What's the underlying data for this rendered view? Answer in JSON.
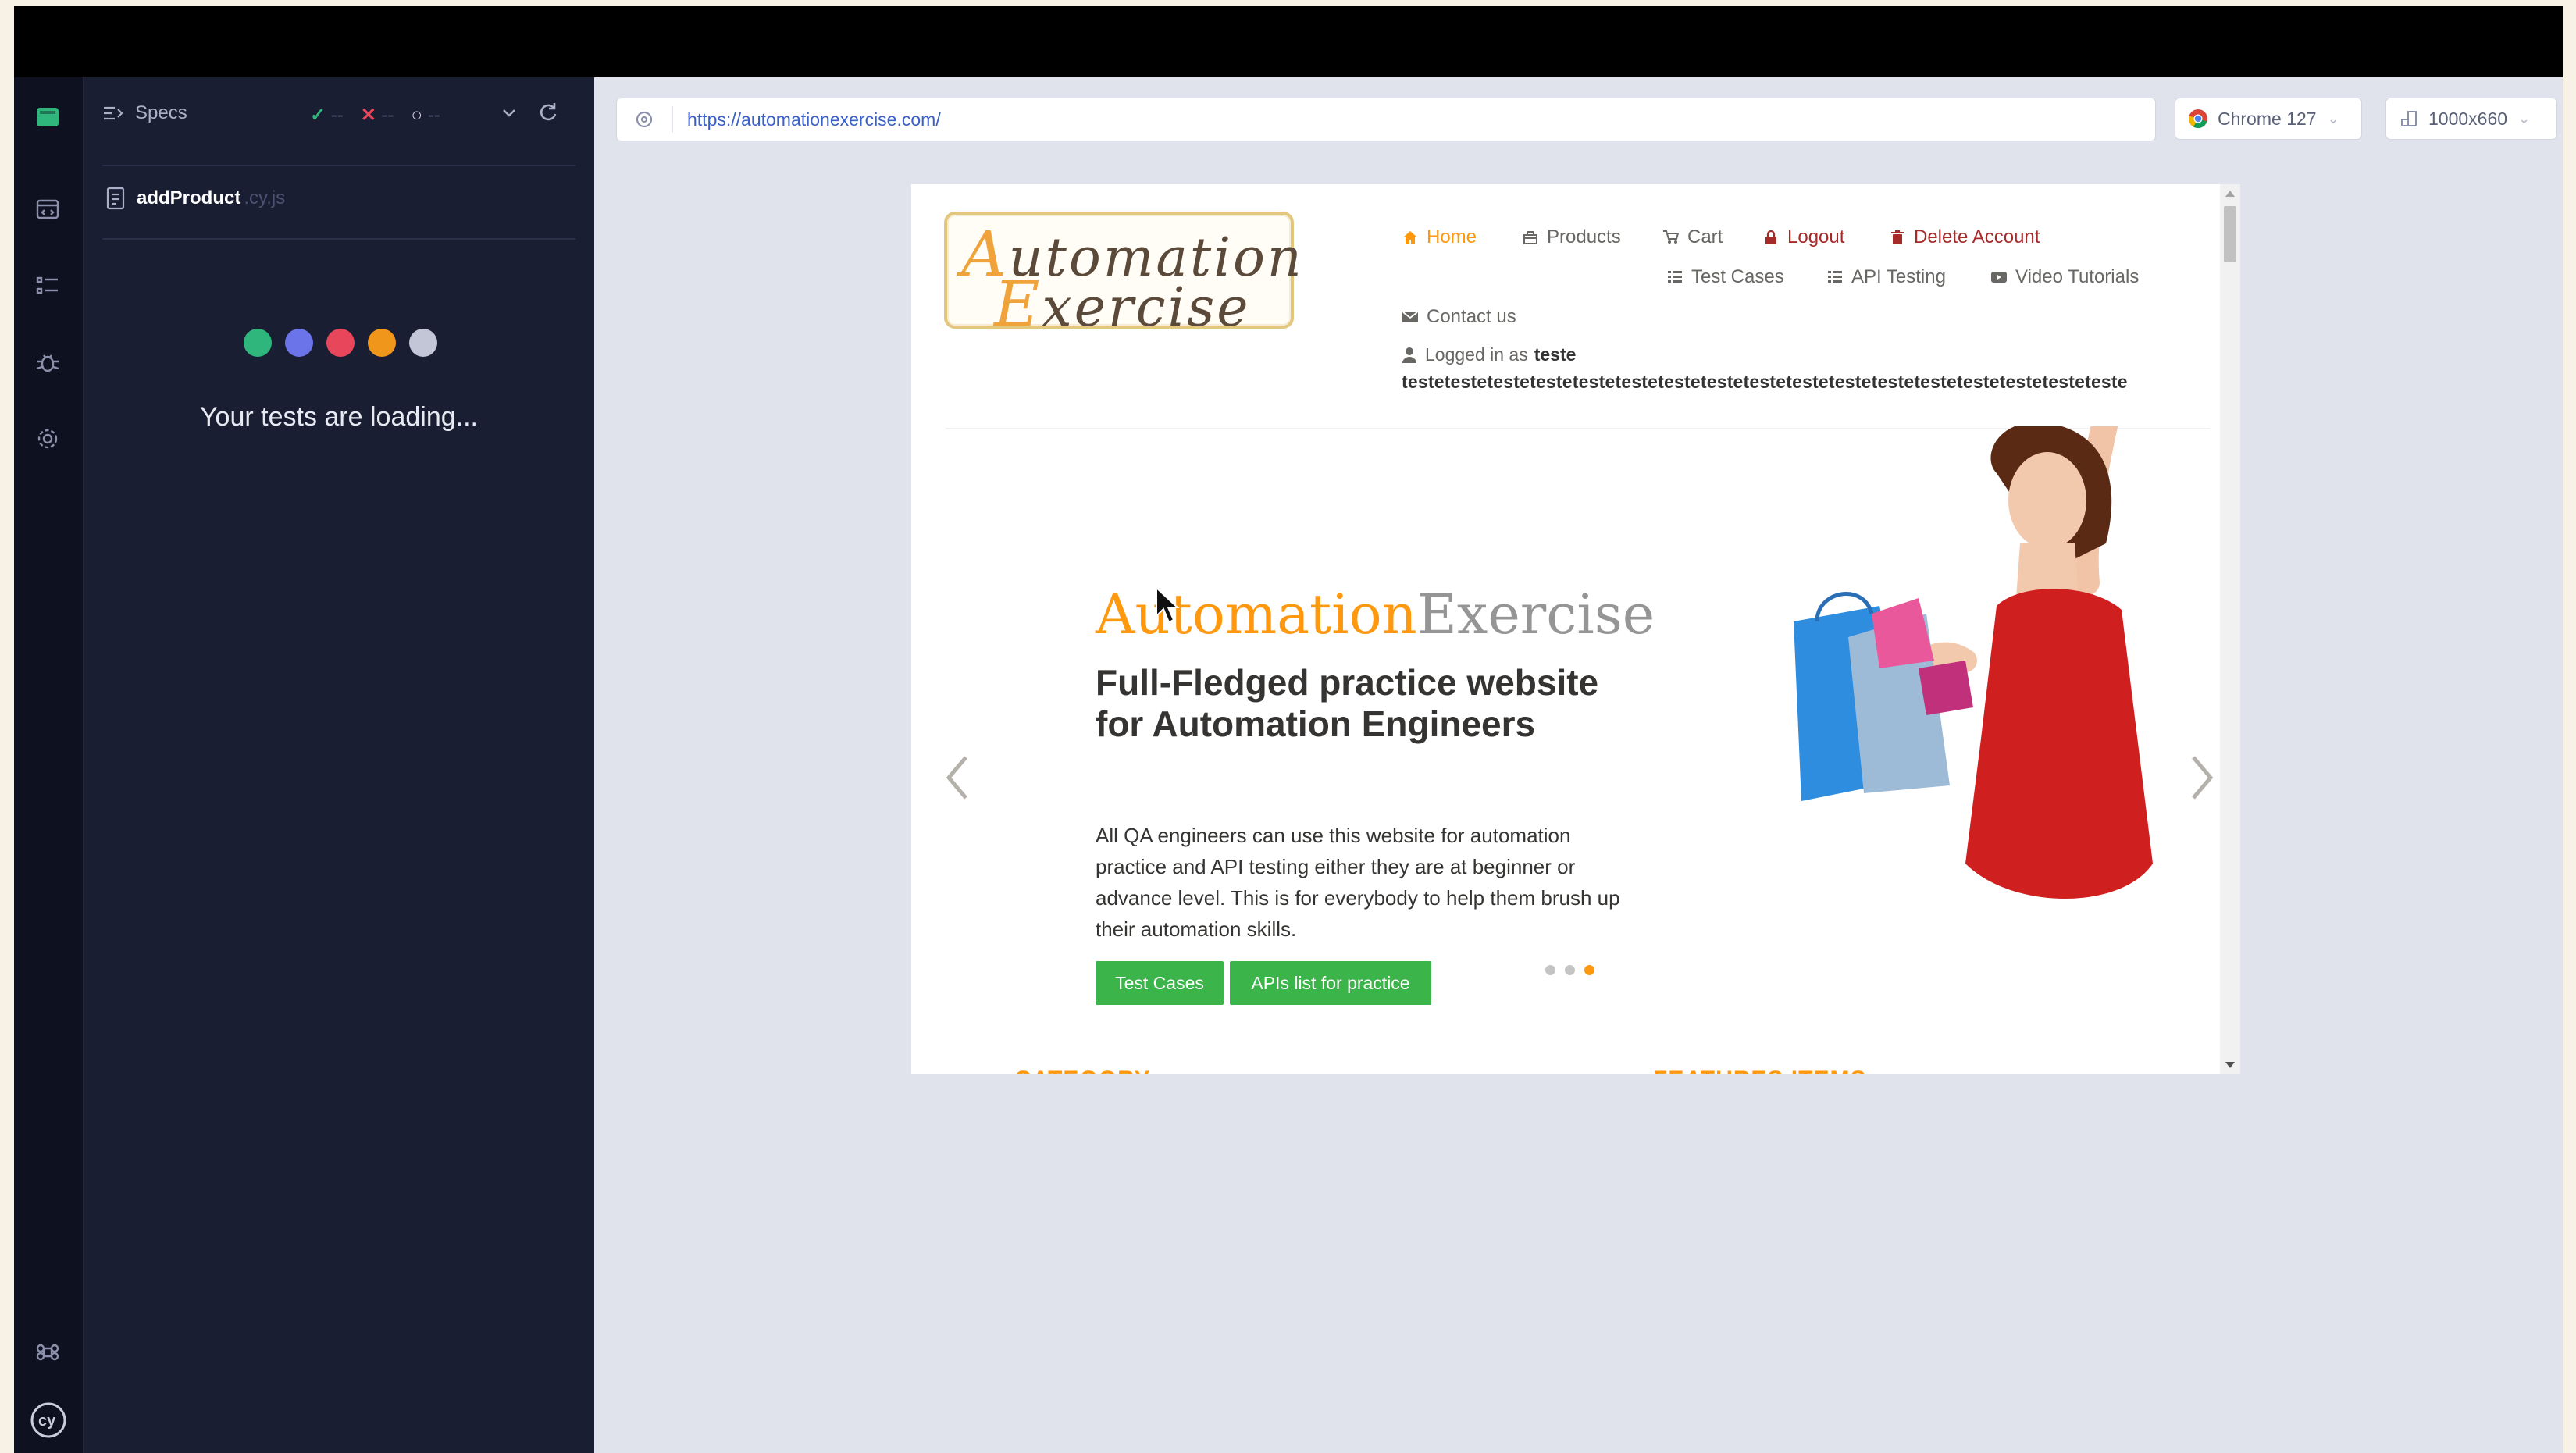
{
  "colors": {
    "cypress_dark": "#1a1e33",
    "cypress_rail": "#0e1120",
    "pass": "#2fb67c",
    "fail": "#e8465b",
    "accent_orange": "#fe980f",
    "green_button": "#3bb54a",
    "link_blue": "#3a61c9"
  },
  "cypress": {
    "specs_label": "Specs",
    "stats": {
      "passed": "✓",
      "failed": "✕",
      "pending": "○",
      "placeholder": "--"
    },
    "spec_file": {
      "name": "addProduct",
      "ext": ".cy.js"
    },
    "loading_text": "Your tests are loading...",
    "loader_dots": [
      "#2fb67c",
      "#6b74e8",
      "#e8465b",
      "#f0961a",
      "#c2c6d6"
    ],
    "rail_icons": [
      "cypress-logo-icon",
      "browser-window-icon",
      "list-icon",
      "bug-icon",
      "gear-icon",
      "command-key-icon",
      "cy-logo-icon"
    ]
  },
  "browser": {
    "url": "https://automationexercise.com/",
    "browser_name": "Chrome 127",
    "viewport_size": "1000x660"
  },
  "site": {
    "logo_line1": "Automation",
    "logo_line2": "Exercise",
    "nav": {
      "home": "Home",
      "products": "Products",
      "cart": "Cart",
      "logout": "Logout",
      "delete_account": "Delete Account",
      "test_cases": "Test Cases",
      "api_testing": "API Testing",
      "video_tutorials": "Video Tutorials",
      "contact_us": "Contact us"
    },
    "logged_in_prefix": "Logged in as",
    "logged_in_user": "teste",
    "logged_in_user_cont": "testetestetestetestetestetestetestetestetestetestetestetestetestetestetestetesteteste",
    "hero": {
      "title_a": "Automation",
      "title_b": "Exercise",
      "subtitle": "Full-Fledged practice website for Automation Engineers",
      "body": "All QA engineers can use this website for automation practice and API testing either they are at beginner or advance level. This is for everybody to help them brush up their automation skills.",
      "btn_test_cases": "Test Cases",
      "btn_apis": "APIs list for practice",
      "carousel_active_index": 2
    },
    "section_left": "CATEGORY",
    "section_right": "FEATURES ITEMS"
  }
}
